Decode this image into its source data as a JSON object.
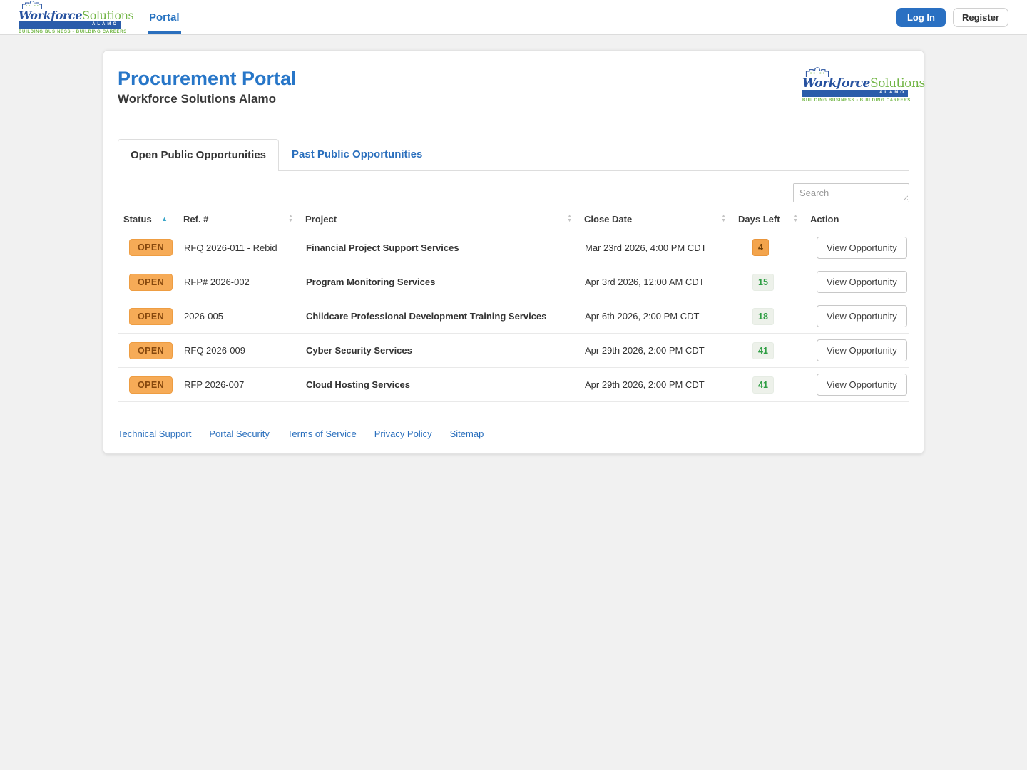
{
  "brand": {
    "name_primary": "Workforce",
    "name_secondary": "Solutions",
    "bar_text": "ALAMO",
    "tagline": "BUILDING BUSINESS • BUILDING CAREERS"
  },
  "nav": {
    "portal_link": "Portal",
    "login_button": "Log In",
    "register_button": "Register"
  },
  "header": {
    "title": "Procurement Portal",
    "subtitle": "Workforce Solutions Alamo"
  },
  "tabs": {
    "open": "Open Public Opportunities",
    "past": "Past Public Opportunities"
  },
  "search": {
    "placeholder": "Search"
  },
  "table": {
    "columns": [
      "Status",
      "Ref. #",
      "Project",
      "Close Date",
      "Days Left",
      "Action"
    ],
    "sorted_column": "Status",
    "sort_direction": "ascending",
    "rows": [
      {
        "status": "OPEN",
        "ref": "RFQ 2026-011 - Rebid",
        "project": "Financial Project Support Services",
        "close_date": "Mar 23rd 2026, 4:00 PM CDT",
        "days_left": "4",
        "days_left_level": "warning",
        "action": "View Opportunity"
      },
      {
        "status": "OPEN",
        "ref": "RFP# 2026-002",
        "project": "Program Monitoring Services",
        "close_date": "Apr 3rd 2026, 12:00 AM CDT",
        "days_left": "15",
        "days_left_level": "ok",
        "action": "View Opportunity"
      },
      {
        "status": "OPEN",
        "ref": "2026-005",
        "project": "Childcare Professional Development Training Services",
        "close_date": "Apr 6th 2026, 2:00 PM CDT",
        "days_left": "18",
        "days_left_level": "ok",
        "action": "View Opportunity"
      },
      {
        "status": "OPEN",
        "ref": "RFQ 2026-009",
        "project": "Cyber Security Services",
        "close_date": "Apr 29th 2026, 2:00 PM CDT",
        "days_left": "41",
        "days_left_level": "ok",
        "action": "View Opportunity"
      },
      {
        "status": "OPEN",
        "ref": "RFP 2026-007",
        "project": "Cloud Hosting Services",
        "close_date": "Apr 29th 2026, 2:00 PM CDT",
        "days_left": "41",
        "days_left_level": "ok",
        "action": "View Opportunity"
      }
    ]
  },
  "footer": {
    "links": [
      "Technical Support",
      "Portal Security",
      "Terms of Service",
      "Privacy Policy",
      "Sitemap"
    ]
  },
  "colors": {
    "accent_blue": "#2a6fbd",
    "title_blue": "#2776c8",
    "logo_blue": "#26519f",
    "logo_green": "#71b544",
    "open_badge_bg": "#f6ab57",
    "open_badge_text": "#86480e",
    "days_warning_bg": "#f3a44c",
    "days_ok_bg": "#edf1ea",
    "days_ok_text": "#2f9e44",
    "sort_active": "#39a5c8"
  }
}
